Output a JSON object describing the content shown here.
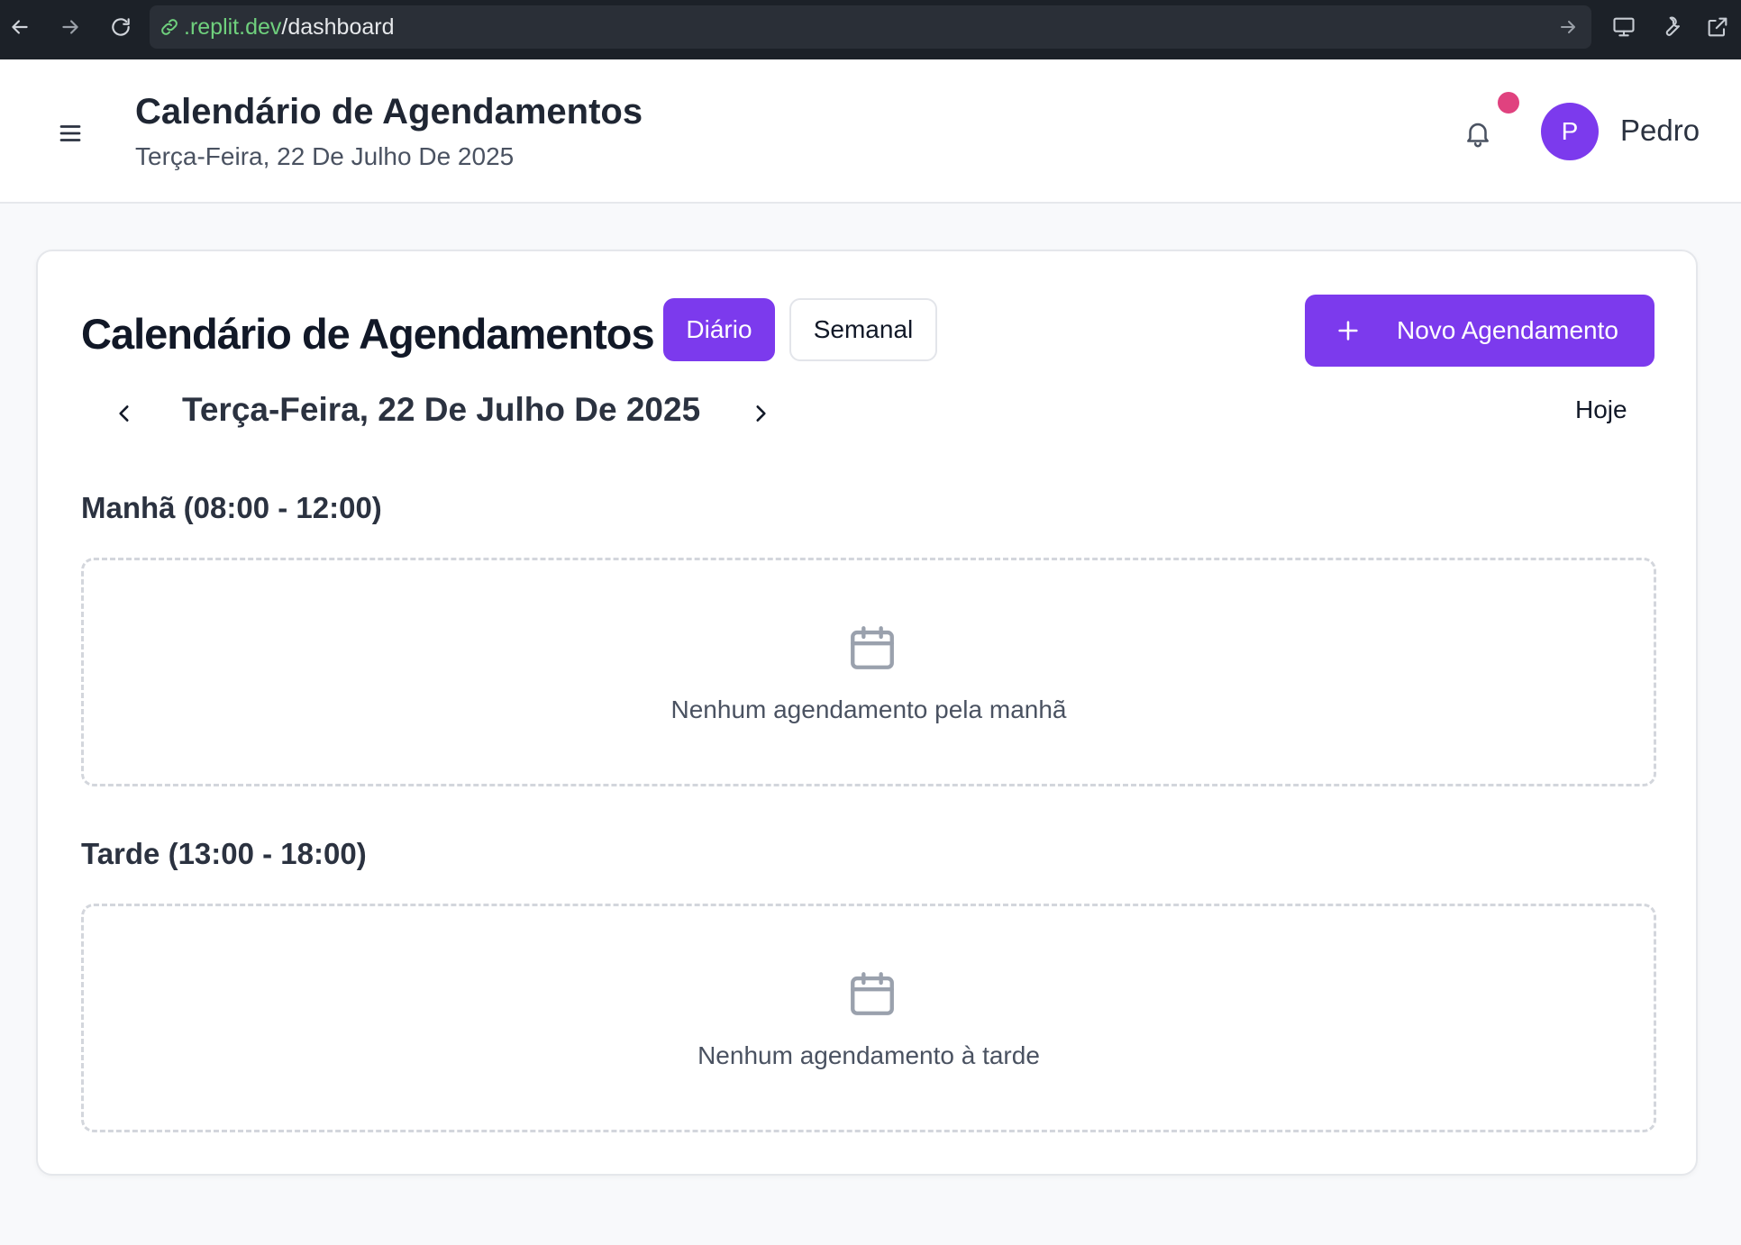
{
  "browser": {
    "url_host": ".replit.dev",
    "url_path": "/dashboard"
  },
  "header": {
    "title": "Calendário de Agendamentos",
    "subtitle": "Terça-Feira, 22 De Julho De 2025",
    "avatar_initial": "P",
    "user_name": "Pedro",
    "notification_dot_color": "#e0427f"
  },
  "card": {
    "title": "Calendário de Agendamentos",
    "view_daily": "Diário",
    "view_weekly": "Semanal",
    "new_button": "Novo Agendamento",
    "date": "Terça-Feira, 22 De Julho De 2025",
    "today": "Hoje",
    "sections": [
      {
        "title": "Manhã (08:00 - 12:00)",
        "empty_text": "Nenhum agendamento pela manhã"
      },
      {
        "title": "Tarde (13:00 - 18:00)",
        "empty_text": "Nenhum agendamento à tarde"
      }
    ]
  },
  "colors": {
    "accent": "#7c3aed",
    "chrome_bg": "#1c2128",
    "url_host": "#6fd07d"
  },
  "icons": [
    "back-arrow-icon",
    "forward-arrow-icon",
    "reload-icon",
    "link-icon",
    "go-arrow-icon",
    "monitor-icon",
    "wrench-icon",
    "external-link-icon",
    "menu-icon",
    "bell-icon",
    "plus-icon",
    "chevron-left-icon",
    "chevron-right-icon",
    "calendar-icon"
  ]
}
